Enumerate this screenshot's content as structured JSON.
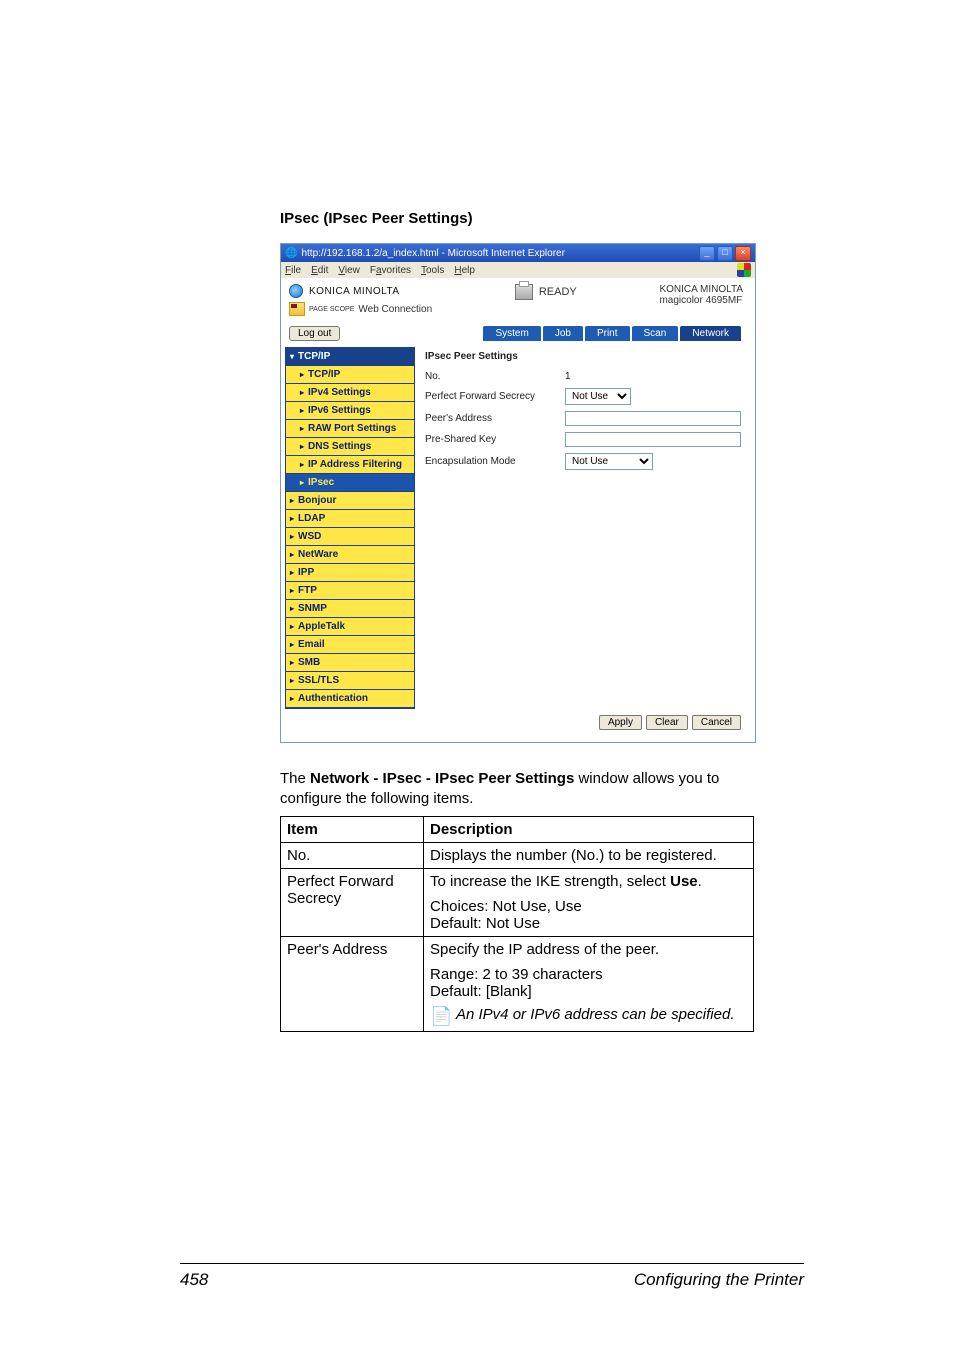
{
  "heading": "IPsec (IPsec Peer Settings)",
  "browser": {
    "title": "http://192.168.1.2/a_index.html - Microsoft Internet Explorer",
    "menus": [
      "File",
      "Edit",
      "View",
      "Favorites",
      "Tools",
      "Help"
    ],
    "brand": "KONICA MINOLTA",
    "connection_prefix": "PAGE SCOPE",
    "connection_text": "Web Connection",
    "status": "READY",
    "model_line1": "KONICA MINOLTA",
    "model_line2": "magicolor 4695MF",
    "logout": "Log out",
    "tabs": [
      "System",
      "Job",
      "Print",
      "Scan",
      "Network"
    ],
    "selected_tab": "Network",
    "sidebar": [
      {
        "label": "TCP/IP",
        "top": true
      },
      {
        "label": "TCP/IP",
        "sub": true
      },
      {
        "label": "IPv4 Settings",
        "sub": true
      },
      {
        "label": "IPv6 Settings",
        "sub": true
      },
      {
        "label": "RAW Port Settings",
        "sub": true
      },
      {
        "label": "DNS Settings",
        "sub": true
      },
      {
        "label": "IP Address Filtering",
        "sub": true
      },
      {
        "label": "IPsec",
        "sub": true,
        "sel": true
      },
      {
        "label": "Bonjour"
      },
      {
        "label": "LDAP"
      },
      {
        "label": "WSD"
      },
      {
        "label": "NetWare"
      },
      {
        "label": "IPP"
      },
      {
        "label": "FTP"
      },
      {
        "label": "SNMP"
      },
      {
        "label": "AppleTalk"
      },
      {
        "label": "Email"
      },
      {
        "label": "SMB"
      },
      {
        "label": "SSL/TLS"
      },
      {
        "label": "Authentication"
      }
    ],
    "content": {
      "title": "IPsec Peer Settings",
      "rows": {
        "no_label": "No.",
        "no_value": "1",
        "pfs_label": "Perfect Forward Secrecy",
        "pfs_value": "Not Use",
        "peer_label": "Peer's Address",
        "peer_value": "",
        "psk_label": "Pre-Shared Key",
        "psk_value": "",
        "enc_label": "Encapsulation Mode",
        "enc_value": "Not Use"
      }
    },
    "buttons": {
      "apply": "Apply",
      "clear": "Clear",
      "cancel": "Cancel"
    }
  },
  "paragraph_pre": "The ",
  "paragraph_bold": "Network - IPsec - IPsec Peer Settings",
  "paragraph_post": " window allows you to configure the following items.",
  "table": {
    "head_item": "Item",
    "head_desc": "Description",
    "rows": {
      "no_item": "No.",
      "no_desc": "Displays the number (No.) to be registered.",
      "pfs_item": "Perfect Forward Secrecy",
      "pfs_desc1_pre": "To increase the IKE strength, select ",
      "pfs_desc1_bold": "Use",
      "pfs_desc1_post": ".",
      "pfs_desc2": "Choices: Not Use, Use",
      "pfs_desc3": "Default:  Not Use",
      "peer_item": "Peer's Address",
      "peer_desc1": "Specify the IP address of the peer.",
      "peer_desc2": "Range:   2 to 39 characters",
      "peer_desc3": "Default:  [Blank]",
      "peer_note": "An IPv4 or IPv6 address can be specified."
    }
  },
  "footer": {
    "page": "458",
    "title": "Configuring the Printer"
  }
}
